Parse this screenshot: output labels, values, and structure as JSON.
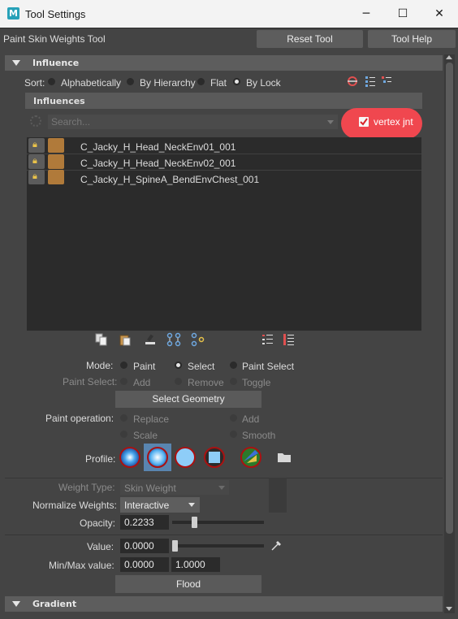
{
  "window": {
    "title": "Tool Settings",
    "minimize": "─",
    "maximize": "☐",
    "close": "✕"
  },
  "header": {
    "tool_name": "Paint Skin Weights Tool",
    "reset_tool": "Reset Tool",
    "tool_help": "Tool Help"
  },
  "influence": {
    "section_title": "Influence",
    "sort_label": "Sort:",
    "sort_options": [
      "Alphabetically",
      "By Hierarchy",
      "Flat",
      "By Lock"
    ],
    "sort_selected": "By Lock",
    "influences_header": "Influences",
    "search_placeholder": "Search...",
    "vertex_jnt_label": "vertex jnt",
    "vertex_jnt_checked": true,
    "joints": [
      "C_Jacky_H_Head_NeckEnv01_001",
      "C_Jacky_H_Head_NeckEnv02_001",
      "C_Jacky_H_SpineA_BendEnvChest_001"
    ]
  },
  "mode": {
    "label": "Mode:",
    "options": [
      "Paint",
      "Select",
      "Paint Select"
    ],
    "selected": "Select",
    "paint_select_label": "Paint Select:",
    "paint_select_options": [
      "Add",
      "Remove",
      "Toggle"
    ],
    "select_geometry": "Select Geometry"
  },
  "paint_operation": {
    "label": "Paint operation:",
    "options": [
      "Replace",
      "Add",
      "Scale",
      "Smooth"
    ]
  },
  "profile": {
    "label": "Profile:"
  },
  "weights": {
    "weight_type_label": "Weight Type:",
    "weight_type_value": "Skin Weight",
    "normalize_label": "Normalize Weights:",
    "normalize_value": "Interactive",
    "opacity_label": "Opacity:",
    "opacity_value": "0.2233",
    "opacity_fraction": 0.2233
  },
  "value": {
    "value_label": "Value:",
    "value": "0.0000",
    "value_fraction": 0.0,
    "minmax_label": "Min/Max value:",
    "min": "0.0000",
    "max": "1.0000",
    "flood": "Flood"
  },
  "gradient": {
    "section_title": "Gradient"
  },
  "colors": {
    "annotation_red": "#f0474f",
    "swatch": "#b07a3a",
    "bg": "#444444"
  }
}
